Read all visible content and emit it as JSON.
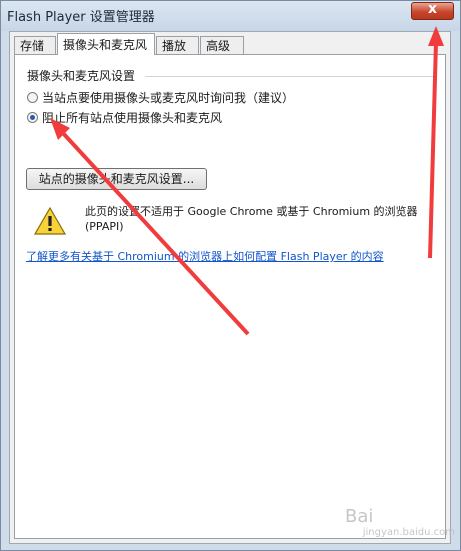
{
  "window": {
    "title": "Flash Player 设置管理器",
    "close_glyph": "x"
  },
  "tabs": [
    {
      "label": "存储",
      "active": false
    },
    {
      "label": "摄像头和麦克风",
      "active": true
    },
    {
      "label": "播放",
      "active": false
    },
    {
      "label": "高级",
      "active": false
    }
  ],
  "camera_mic": {
    "group_title": "摄像头和麦克风设置",
    "options": [
      {
        "label": "当站点要使用摄像头或麦克风时询问我（建议）",
        "selected": false
      },
      {
        "label": "阻止所有站点使用摄像头和麦克风",
        "selected": true
      }
    ],
    "site_settings_button": "站点的摄像头和麦克风设置...",
    "warning_text": "此页的设置不适用于 Google Chrome 或基于 Chromium 的浏览器 (PPAPI)",
    "link_text": "了解更多有关基于 Chromium 的浏览器上如何配置 Flash Player 的内容"
  },
  "watermark": {
    "brand": "Bai",
    "sub": "jingyan.baidu.com"
  },
  "colors": {
    "annotation_arrow": "#f03c3c",
    "link": "#1155cc",
    "close_button": "#c9462d"
  }
}
